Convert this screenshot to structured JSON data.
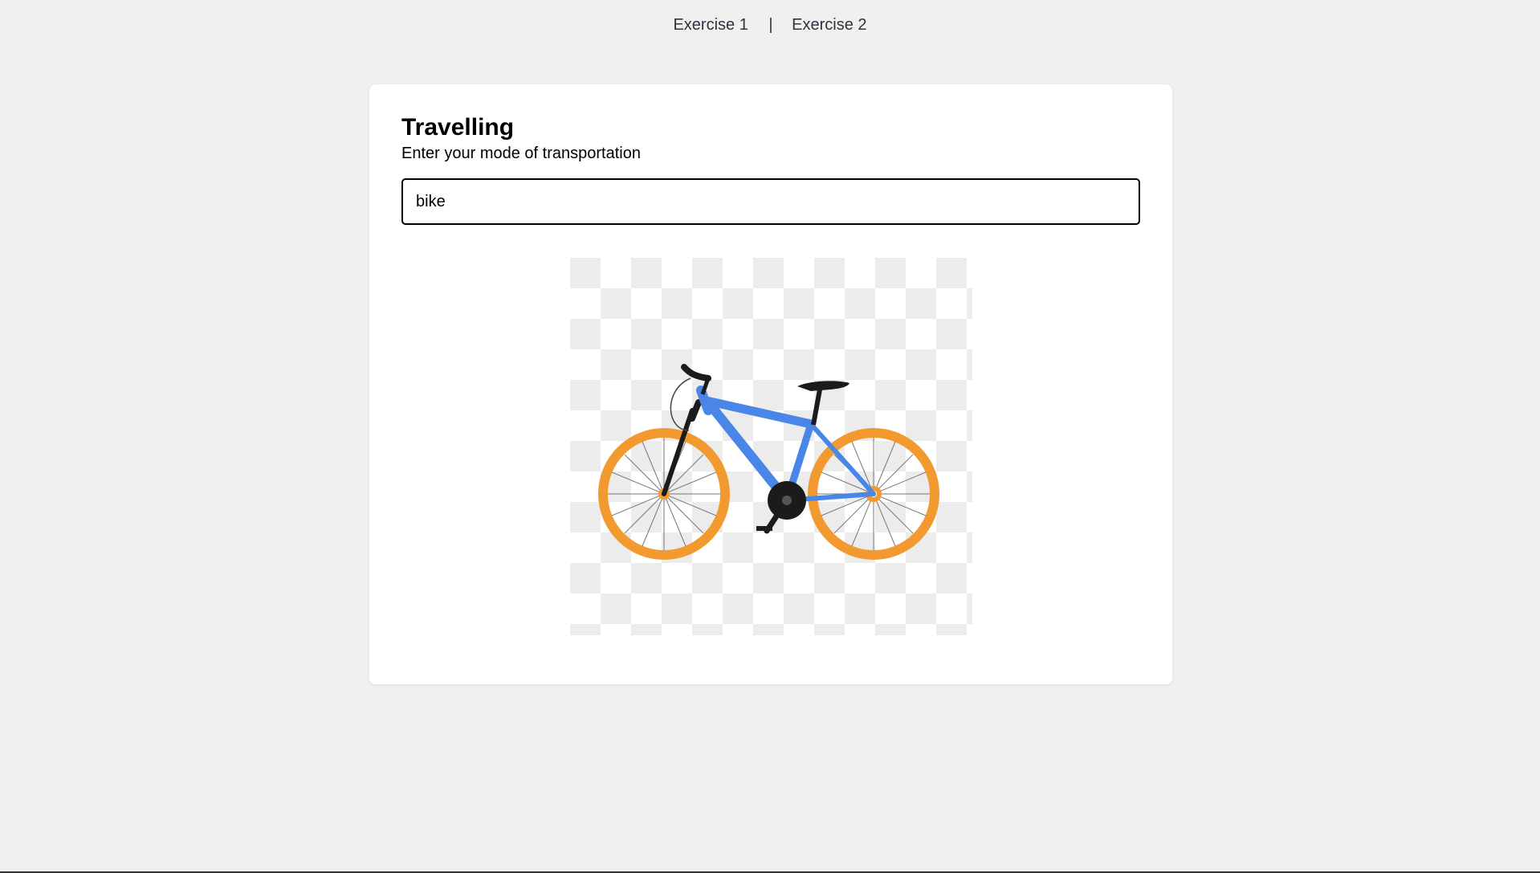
{
  "nav": {
    "items": [
      {
        "label": "Exercise 1"
      },
      {
        "label": "Exercise 2"
      }
    ],
    "separator": "|"
  },
  "card": {
    "title": "Travelling",
    "subtitle": "Enter your mode of transportation",
    "input_value": "bike"
  },
  "image": {
    "subject": "bicycle-image",
    "colors": {
      "frame": "#4a86e8",
      "wheels": "#f29a30",
      "parts": "#1b1b1b"
    }
  }
}
